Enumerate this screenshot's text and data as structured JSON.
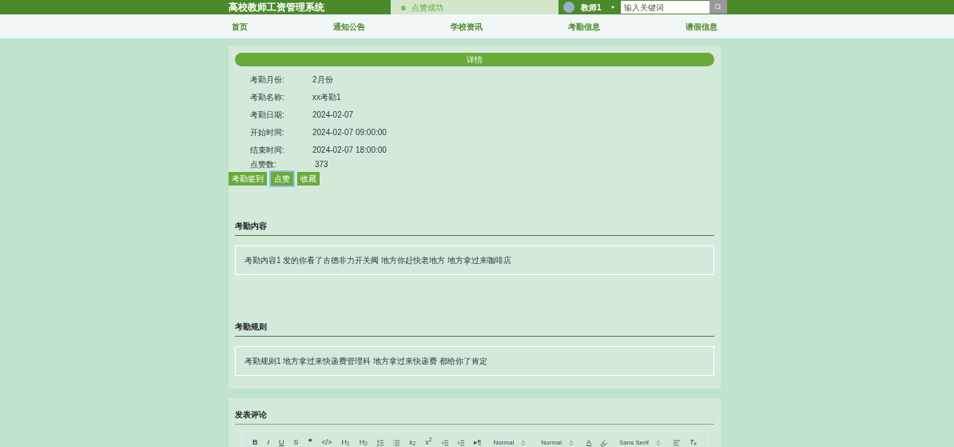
{
  "header": {
    "title": "高校教师工资管理系统",
    "toast": {
      "kind": "success",
      "text": "点赞成功"
    },
    "user": {
      "name": "教师1"
    },
    "search": {
      "placeholder": "输入关键词"
    }
  },
  "nav": [
    {
      "label": "首页",
      "selected": false
    },
    {
      "label": "通知公告",
      "selected": false
    },
    {
      "label": "学校资讯",
      "selected": false
    },
    {
      "label": "考勤信息",
      "selected": false
    },
    {
      "label": "请假信息",
      "selected": false
    }
  ],
  "detail": {
    "title": "详情",
    "fields": [
      {
        "label": "考勤月份:",
        "value": "2月份"
      },
      {
        "label": "考勤名称:",
        "value": "xx考勤1"
      },
      {
        "label": "考勤日期:",
        "value": "2024-02-07"
      },
      {
        "label": "开始时间:",
        "value": "2024-02-07 09:00:00"
      },
      {
        "label": "结束时间:",
        "value": "2024-02-07 18:00:00"
      }
    ],
    "likes": {
      "label": "点赞数:",
      "value": "373"
    },
    "actions": [
      {
        "label": "考勤签到",
        "selected": false
      },
      {
        "label": "点赞",
        "selected": true
      },
      {
        "label": "收藏",
        "selected": false
      }
    ],
    "sections": [
      {
        "title": "考勤内容",
        "text": "考勤内容1 发的你看了古德非力开关阀 地方你赶快老地方 地方拿过来咖啡店"
      },
      {
        "title": "考勤规则",
        "text": "考勤规则1 地方拿过来快递费管理科 地方拿过来快递费 都给你了肯定"
      }
    ]
  },
  "comment": {
    "title": "发表评论",
    "toolbar": [
      {
        "kind": "bold",
        "label": "B"
      },
      {
        "kind": "italic",
        "label": "I"
      },
      {
        "kind": "underline",
        "label": "U"
      },
      {
        "kind": "plain",
        "label": "S"
      },
      {
        "kind": "bold",
        "label": "❞"
      },
      {
        "kind": "plain",
        "label": "</>"
      },
      {
        "kind": "plain",
        "label": "H$_{1}$"
      },
      {
        "kind": "plain",
        "label": "H$_{2}$"
      },
      {
        "kind": "numbered"
      },
      {
        "kind": "bullets"
      },
      {
        "kind": "plain",
        "label": "x$_{2}$"
      },
      {
        "kind": "plain",
        "label": "x$^{2}$"
      },
      {
        "kind": "outdent"
      },
      {
        "kind": "indent"
      },
      {
        "kind": "plain",
        "label": "▸¶"
      },
      {
        "kind": "select",
        "label": "Normal"
      },
      {
        "kind": "select",
        "label": "Normal"
      },
      {
        "kind": "underline",
        "label": "A"
      },
      {
        "kind": "highlight"
      },
      {
        "kind": "select",
        "label": "Sans Serif"
      },
      {
        "kind": "align"
      },
      {
        "kind": "italic",
        "label": "T$_{x}$"
      }
    ]
  }
}
